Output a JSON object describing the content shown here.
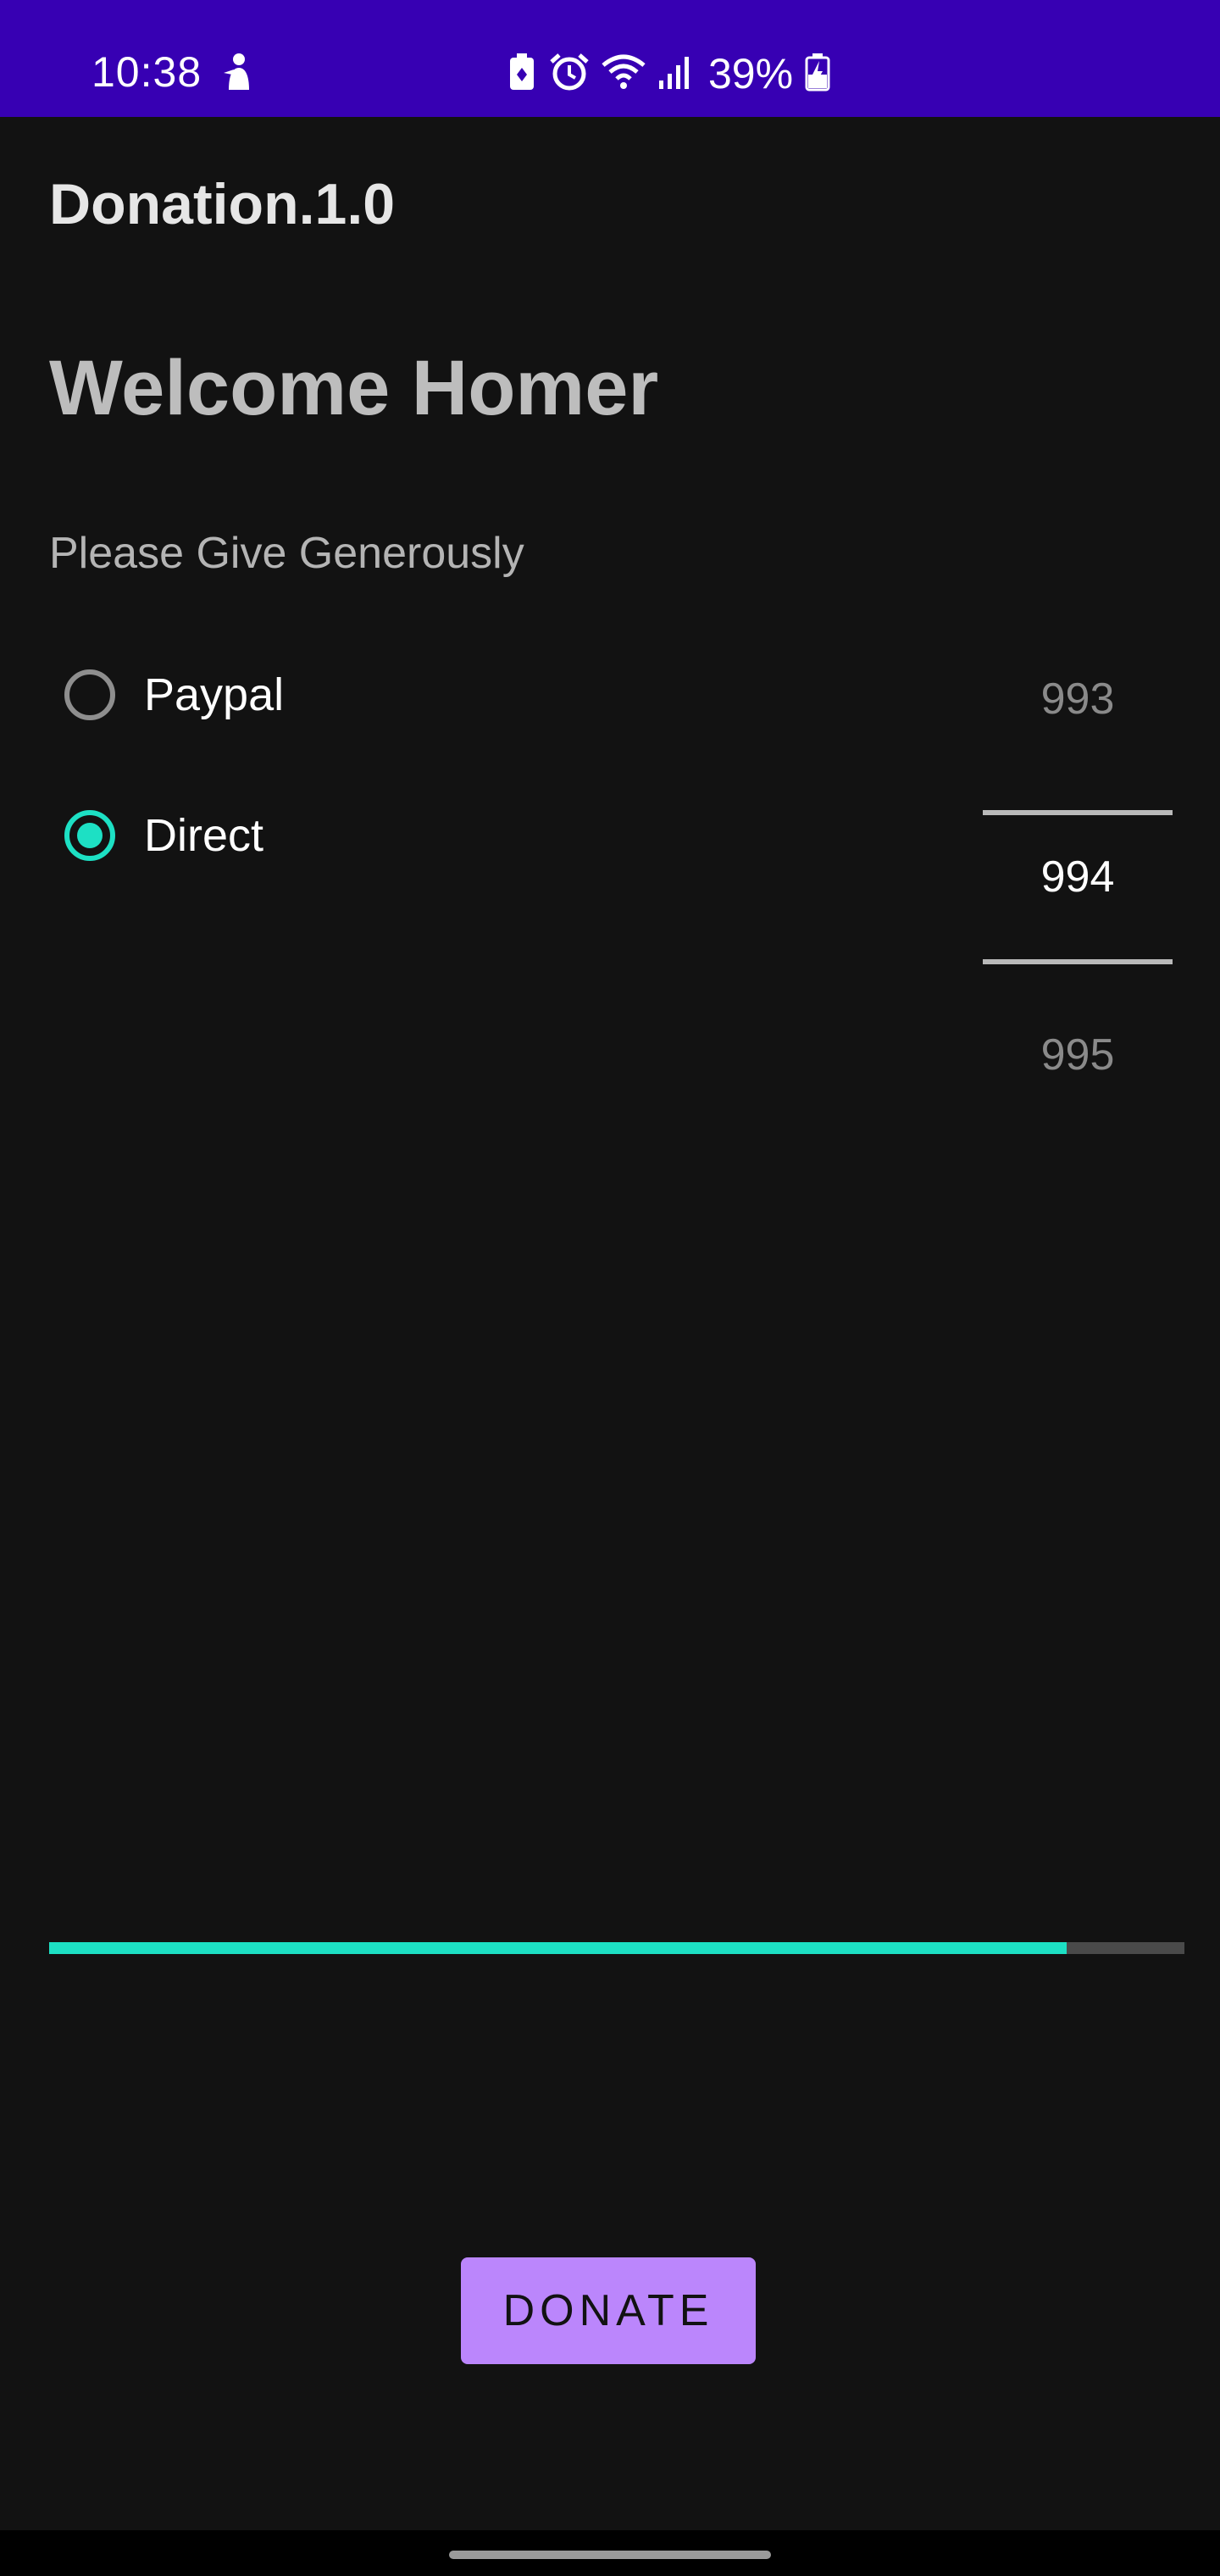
{
  "status_bar": {
    "time": "10:38",
    "battery_percent": "39%",
    "icons": [
      "notification-figure-icon",
      "battery-saver-icon",
      "alarm-icon",
      "wifi-icon",
      "signal-icon",
      "battery-charging-icon"
    ],
    "background_color": "#3700b3"
  },
  "app_bar": {
    "title": "Donation.1.0"
  },
  "main": {
    "welcome": "Welcome Homer",
    "subtitle": "Please Give Generously",
    "payment_methods": [
      {
        "label": "Paypal",
        "selected": false
      },
      {
        "label": "Direct",
        "selected": true
      }
    ],
    "amount_picker": {
      "previous": "993",
      "current": "994",
      "next": "995"
    },
    "progress": {
      "fraction": 0.896
    },
    "donate_label": "DONATE"
  },
  "colors": {
    "accent": "#1de0c4",
    "button": "#bb86fc",
    "background": "#121212"
  }
}
